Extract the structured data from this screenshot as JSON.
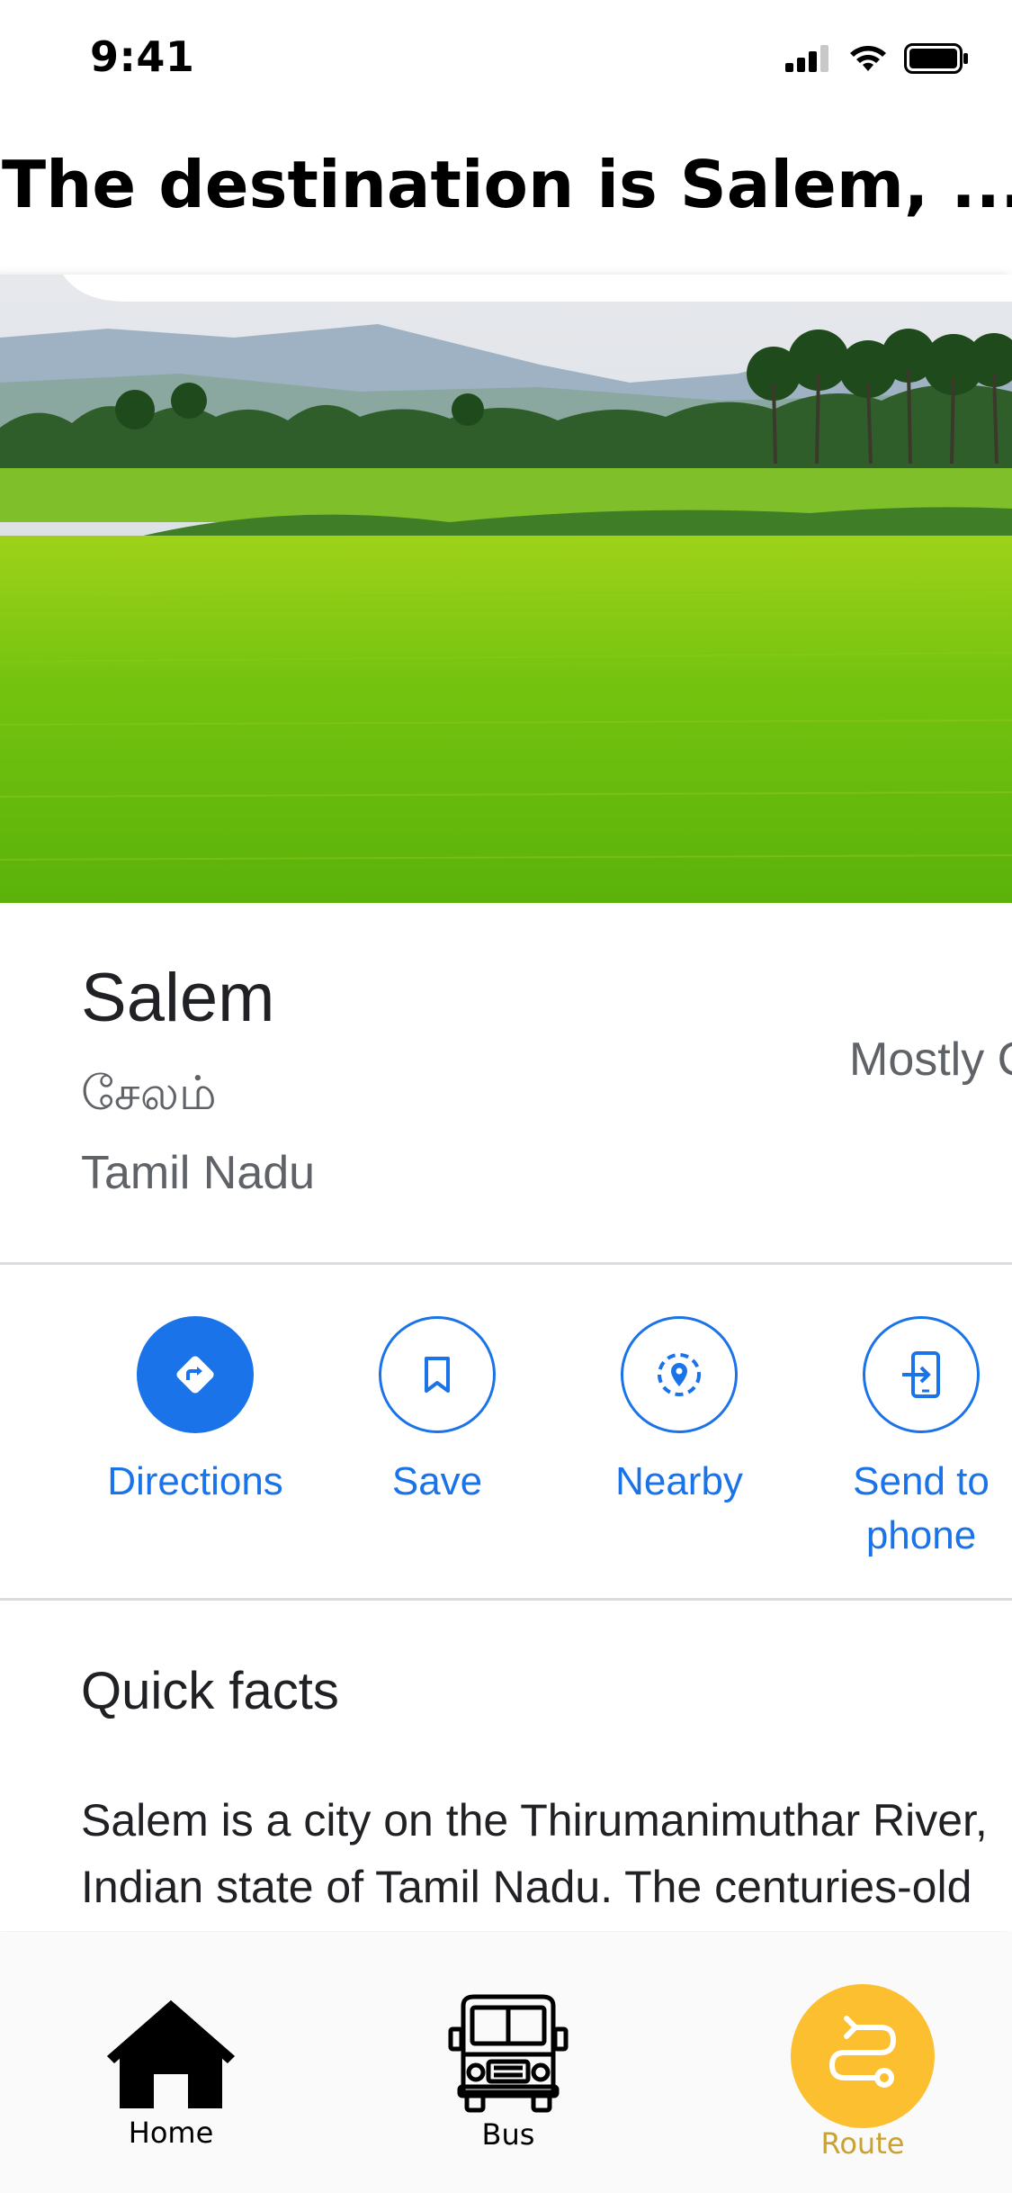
{
  "status_bar": {
    "time": "9:41"
  },
  "header": {
    "title": "The destination is Salem, ...."
  },
  "place": {
    "name": "Salem",
    "local_name": "சேலம்",
    "region": "Tamil Nadu",
    "weather_text": "Mostly C"
  },
  "actions": [
    {
      "label": "Directions",
      "icon": "directions-icon"
    },
    {
      "label": "Save",
      "icon": "bookmark-icon"
    },
    {
      "label": "Nearby",
      "icon": "nearby-icon"
    },
    {
      "label": "Send to\nphone",
      "icon": "send-to-phone-icon"
    }
  ],
  "quick_facts": {
    "title": "Quick facts",
    "line1": "Salem is a city on the Thirumanimuthar River,",
    "line2": "Indian state of Tamil Nadu. The centuries-old"
  },
  "bottom_nav": [
    {
      "label": "Home",
      "icon": "home-icon",
      "active": false
    },
    {
      "label": "Bus",
      "icon": "bus-icon",
      "active": false
    },
    {
      "label": "Route",
      "icon": "route-icon",
      "active": true
    }
  ],
  "colors": {
    "accent_blue": "#1a73e8",
    "route_yellow": "#fbbf2f",
    "route_label": "#c9a233"
  }
}
